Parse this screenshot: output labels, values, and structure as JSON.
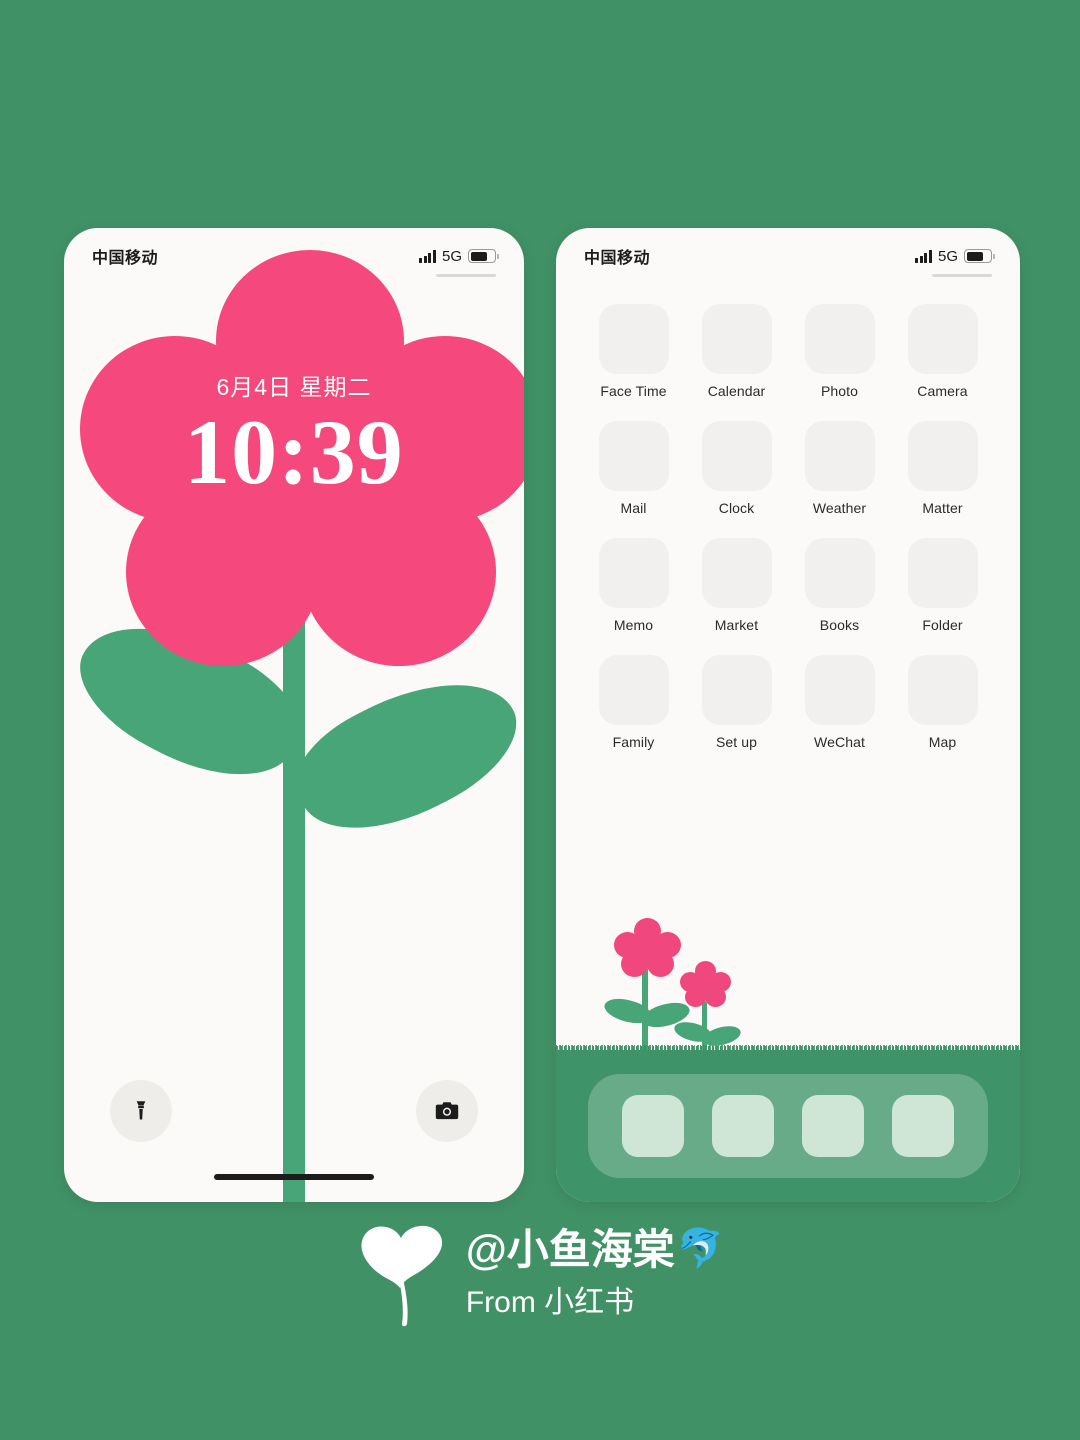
{
  "background_color": "#419166",
  "status_bar": {
    "carrier": "中国移动",
    "network": "5G",
    "signal_icon": "signal-bars-icon",
    "battery_icon": "battery-icon",
    "battery_level_percent": 72
  },
  "lock_screen": {
    "name": "lock-screen",
    "date": "6月4日 星期二",
    "time": "10:39",
    "wallpaper": {
      "description": "pink five-petal flower with green stem and two leaves",
      "flower_color": "#F5497E",
      "stem_color": "#47A578",
      "screen_background": "#FCFAF8"
    },
    "flashlight_icon": "flashlight-icon",
    "camera_icon": "camera-icon",
    "home_indicator": "home-indicator"
  },
  "home_screen": {
    "name": "home-screen",
    "icon_placeholder_color": "#F2F0EE",
    "apps": [
      {
        "label": "Face Time"
      },
      {
        "label": "Calendar"
      },
      {
        "label": "Photo"
      },
      {
        "label": "Camera"
      },
      {
        "label": "Mail"
      },
      {
        "label": "Clock"
      },
      {
        "label": "Weather"
      },
      {
        "label": "Matter"
      },
      {
        "label": "Memo"
      },
      {
        "label": "Market"
      },
      {
        "label": "Books"
      },
      {
        "label": "Folder"
      },
      {
        "label": "Family"
      },
      {
        "label": "Set up"
      },
      {
        "label": "WeChat"
      },
      {
        "label": "Map"
      }
    ],
    "dock": {
      "slot_count": 4,
      "slot_color": "#CFE6D6",
      "tray_color": "rgba(255,255,255,0.22)"
    },
    "decoration": {
      "grass_color": "#3E9468",
      "flower_color": "#F0487E",
      "flower_count": 2
    }
  },
  "attribution": {
    "heart_icon": "heart-leaf-icon",
    "username": "@小鱼海棠",
    "dolphin_emoji": "🐬",
    "source": "From 小红书"
  }
}
